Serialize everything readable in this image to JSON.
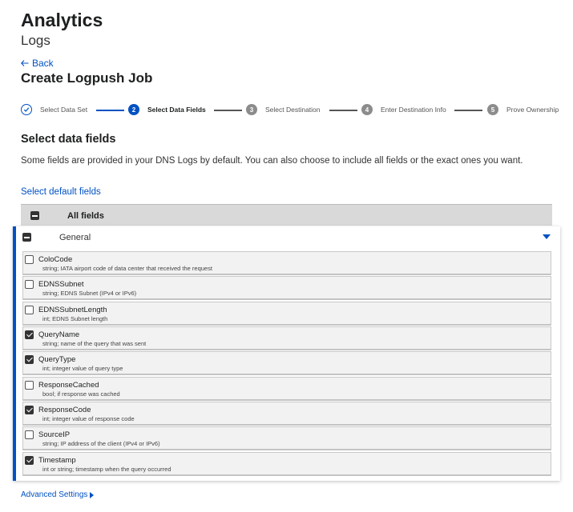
{
  "header": {
    "title": "Analytics",
    "subtitle": "Logs",
    "back_label": "Back",
    "job_title": "Create Logpush Job"
  },
  "stepper": {
    "steps": [
      {
        "number": "",
        "label": "Select Data Set",
        "state": "done"
      },
      {
        "number": "2",
        "label": "Select Data Fields",
        "state": "active"
      },
      {
        "number": "3",
        "label": "Select Destination",
        "state": "pending"
      },
      {
        "number": "4",
        "label": "Enter Destination Info",
        "state": "pending"
      },
      {
        "number": "5",
        "label": "Prove Ownership",
        "state": "pending"
      }
    ]
  },
  "section": {
    "title": "Select data fields",
    "description": "Some fields are provided in your DNS Logs by default. You can also choose to include all fields or the exact ones you want.",
    "default_link": "Select default fields"
  },
  "table": {
    "all_fields_label": "All fields",
    "group_label": "General",
    "fields": [
      {
        "name": "ColoCode",
        "desc": "string; IATA airport code of data center that received the request",
        "checked": false
      },
      {
        "name": "EDNSSubnet",
        "desc": "string; EDNS Subnet (IPv4 or IPv6)",
        "checked": false
      },
      {
        "name": "EDNSSubnetLength",
        "desc": "int; EDNS Subnet length",
        "checked": false
      },
      {
        "name": "QueryName",
        "desc": "string; name of the query that was sent",
        "checked": true
      },
      {
        "name": "QueryType",
        "desc": "int; integer value of query type",
        "checked": true
      },
      {
        "name": "ResponseCached",
        "desc": "bool; if response was cached",
        "checked": false
      },
      {
        "name": "ResponseCode",
        "desc": "int; integer value of response code",
        "checked": true
      },
      {
        "name": "SourceIP",
        "desc": "string; IP address of the client (IPv4 or IPv6)",
        "checked": false
      },
      {
        "name": "Timestamp",
        "desc": "int or string; timestamp when the query occurred",
        "checked": true
      }
    ]
  },
  "footer": {
    "advanced_label": "Advanced Settings"
  },
  "colors": {
    "accent": "#0051c3",
    "pending_step": "#8c8c8c",
    "row_bg": "#f2f2f2",
    "header_bar": "#d9d9d9"
  }
}
